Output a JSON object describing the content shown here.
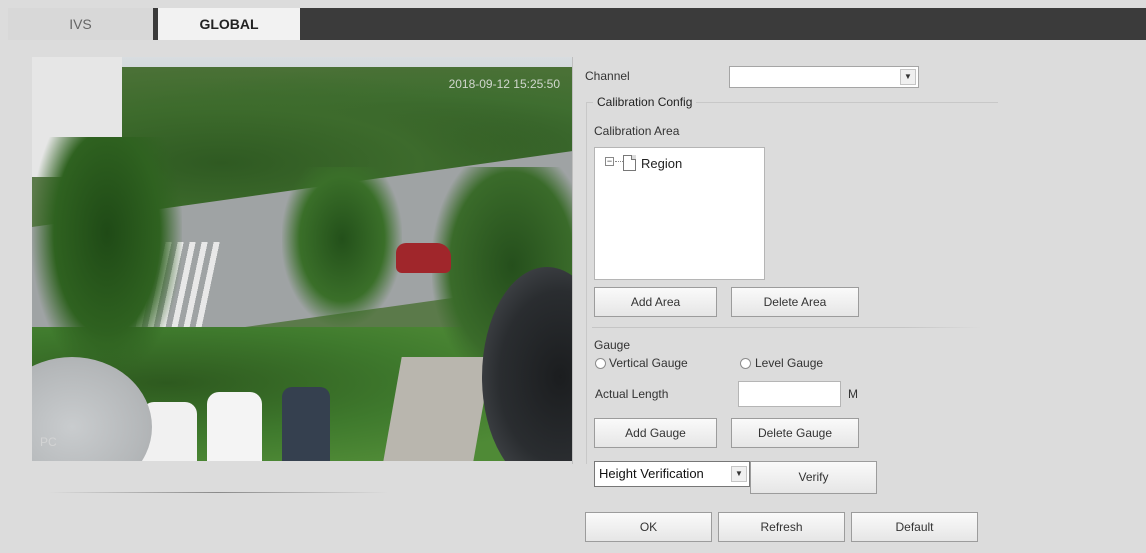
{
  "tabs": [
    {
      "label": "IVS"
    },
    {
      "label": "GLOBAL"
    }
  ],
  "video": {
    "timestamp": "2018-09-12 15:25:50",
    "watermark": "PC"
  },
  "channel": {
    "label": "Channel",
    "value": ""
  },
  "calibration": {
    "legend": "Calibration Config",
    "area_label": "Calibration Area",
    "tree_node": "Region",
    "add_area": "Add Area",
    "delete_area": "Delete Area"
  },
  "gauge": {
    "label": "Gauge",
    "vertical": "Vertical Gauge",
    "level": "Level Gauge",
    "length_label": "Actual Length",
    "length_value": "",
    "unit": "M",
    "add": "Add Gauge",
    "delete": "Delete Gauge"
  },
  "verification": {
    "mode": "Height Verification",
    "verify": "Verify"
  },
  "footer": {
    "ok": "OK",
    "refresh": "Refresh",
    "default": "Default"
  }
}
